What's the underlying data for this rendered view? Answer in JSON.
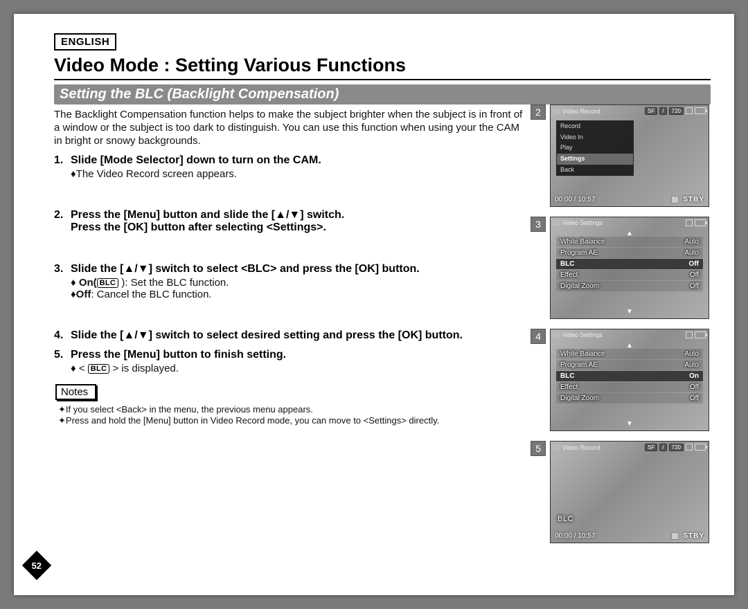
{
  "header": {
    "language": "ENGLISH",
    "title": "Video Mode : Setting Various Functions",
    "subtitle": "Setting the BLC (Backlight Compensation)"
  },
  "intro": "The Backlight Compensation function helps to make the subject brighter when the subject is in front of a window or the subject is too dark to distinguish. You can use this function when using your the CAM in bright or snowy backgrounds.",
  "steps": [
    {
      "num": "1.",
      "head": "Slide [Mode Selector] down to turn on the CAM.",
      "sub": [
        "The Video Record screen appears."
      ]
    },
    {
      "num": "2.",
      "head_line1": "Press the [Menu] button and slide the [▲/▼] switch.",
      "head_line2": "Press the [OK] button after selecting <Settings>."
    },
    {
      "num": "3.",
      "head": "Slide the [▲/▼] switch to select <BLC> and press the [OK] button.",
      "sub_on_prefix": "On(",
      "sub_on_suffix": "): Set the BLC function.",
      "sub_off": "Off: Cancel the BLC function."
    },
    {
      "num": "4.",
      "head": "Slide the [▲/▼] switch to select desired setting and press the [OK] button."
    },
    {
      "num": "5.",
      "head": "Press the [Menu] button to finish setting.",
      "sub_disp_prefix": "< ",
      "sub_disp_suffix": " > is displayed."
    }
  ],
  "notes": {
    "label": "Notes",
    "items": [
      "If you select <Back> in the menu, the previous menu appears.",
      "Press and hold the [Menu] button in Video Record mode, you can move to <Settings> directly."
    ]
  },
  "page_number": "52",
  "screens": {
    "s2": {
      "num": "2",
      "title": "Video Record",
      "caps": [
        "SF",
        "/",
        "720"
      ],
      "menu": [
        "Record",
        "Video In",
        "Play",
        "Settings",
        "Back"
      ],
      "menu_selected": "Settings",
      "time": "00:00 / 10:57",
      "status": "STBY"
    },
    "s3": {
      "num": "3",
      "title": "Video Settings",
      "rows": [
        {
          "k": "White Balance",
          "v": "Auto"
        },
        {
          "k": "Program AE",
          "v": "Auto"
        },
        {
          "k": "BLC",
          "v": "Off",
          "sel": true
        },
        {
          "k": "Effect",
          "v": "Off"
        },
        {
          "k": "Digital Zoom",
          "v": "Off"
        }
      ]
    },
    "s4": {
      "num": "4",
      "title": "Video Settings",
      "rows": [
        {
          "k": "White Balance",
          "v": "Auto"
        },
        {
          "k": "Program AE",
          "v": "Auto"
        },
        {
          "k": "BLC",
          "v": "On",
          "sel": true
        },
        {
          "k": "Effect",
          "v": "Off"
        },
        {
          "k": "Digital Zoom",
          "v": "Off"
        }
      ]
    },
    "s5": {
      "num": "5",
      "title": "Video Record",
      "caps": [
        "SF",
        "/",
        "720"
      ],
      "blc_overlay": "BLC",
      "time": "00:00 / 10:57",
      "status": "STBY"
    }
  },
  "blc_badge": "BLC"
}
